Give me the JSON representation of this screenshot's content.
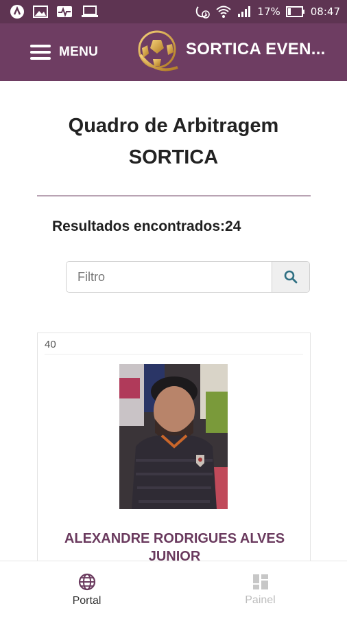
{
  "status_bar": {
    "battery": "17%",
    "time": "08:47",
    "icons_left": [
      "app-icon",
      "image-icon",
      "activity-icon",
      "laptop-icon"
    ],
    "icons_right": [
      "alarm-icon",
      "wifi-icon",
      "signal-icon",
      "battery-icon"
    ]
  },
  "header": {
    "menu_label": "MENU",
    "brand": "SORTICA EVEN...",
    "colors": {
      "bar": "#6e3d62",
      "status": "#5e3452"
    }
  },
  "main": {
    "title_line1": "Quadro de Arbitragem",
    "title_line2": "SORTICA",
    "results_label": "Resultados encontrados:24",
    "filter_placeholder": "Filtro"
  },
  "card": {
    "number": "40",
    "name_line1": "ALEXANDRE RODRIGUES ALVES",
    "name_line2": "JUNIOR"
  },
  "bottom_nav": {
    "items": [
      {
        "label": "Portal",
        "icon": "globe-icon",
        "active": true
      },
      {
        "label": "Painel",
        "icon": "dashboard-icon",
        "active": false
      }
    ]
  },
  "accent_color": "#6a3a5e",
  "search_icon_color": "#2e6f82"
}
